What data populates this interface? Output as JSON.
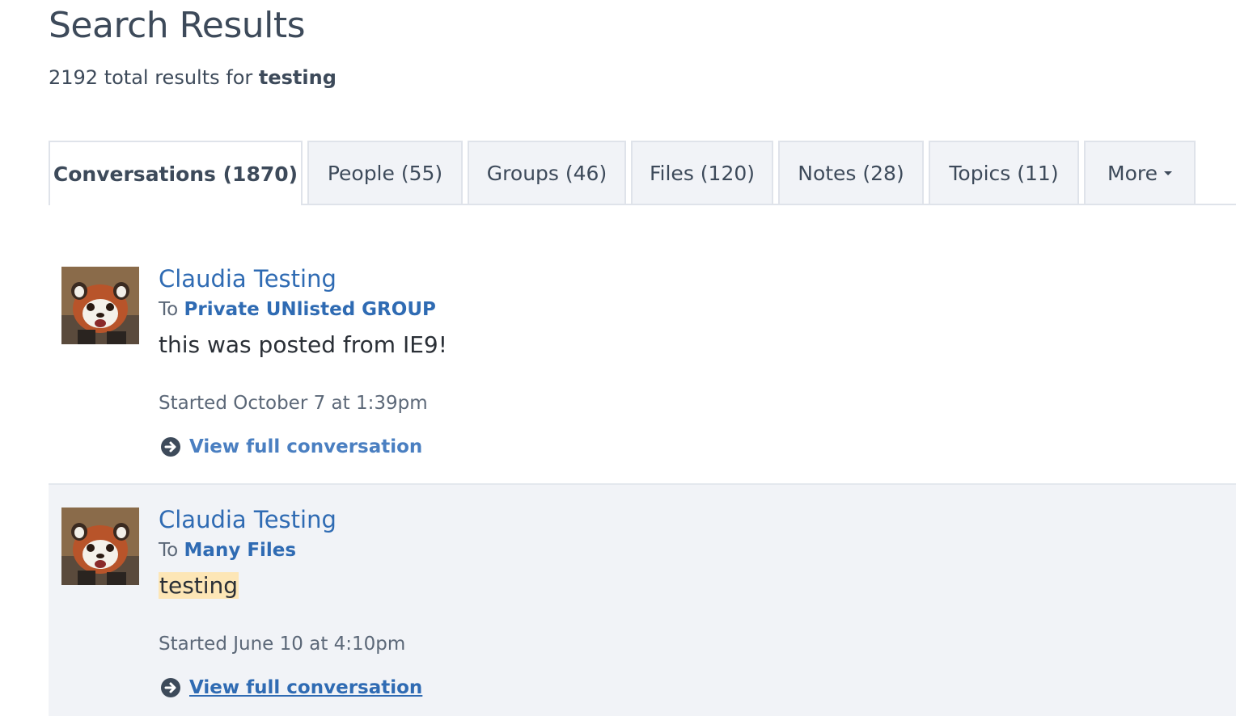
{
  "page": {
    "title": "Search Results",
    "summary_count": "2192 total results for",
    "summary_query": "testing"
  },
  "tabs": [
    {
      "label": "Conversations (1870)",
      "active": true
    },
    {
      "label": "People (55)",
      "active": false
    },
    {
      "label": "Groups (46)",
      "active": false
    },
    {
      "label": "Files (120)",
      "active": false
    },
    {
      "label": "Notes (28)",
      "active": false
    },
    {
      "label": "Topics (11)",
      "active": false
    },
    {
      "label": "More",
      "active": false,
      "icon": "caret-down-icon"
    }
  ],
  "results": [
    {
      "author": "Claudia Testing",
      "to_prefix": "To",
      "group": "Private UNlisted GROUP",
      "message": "this was posted from IE9!",
      "started": "Started October 7 at 1:39pm",
      "link": "View full conversation",
      "avatar_icon": "red-panda-avatar"
    },
    {
      "author": "Claudia Testing",
      "to_prefix": "To",
      "group": "Many Files",
      "message": "testing",
      "started": "Started June 10 at 4:10pm",
      "link": "View full conversation",
      "avatar_icon": "red-panda-avatar"
    }
  ],
  "colors": {
    "link": "#2f6bb3",
    "text": "#3d4a5a",
    "tab_bg": "#f1f3f7",
    "highlight": "#fde6b6",
    "hover_row": "#f1f3f7"
  }
}
